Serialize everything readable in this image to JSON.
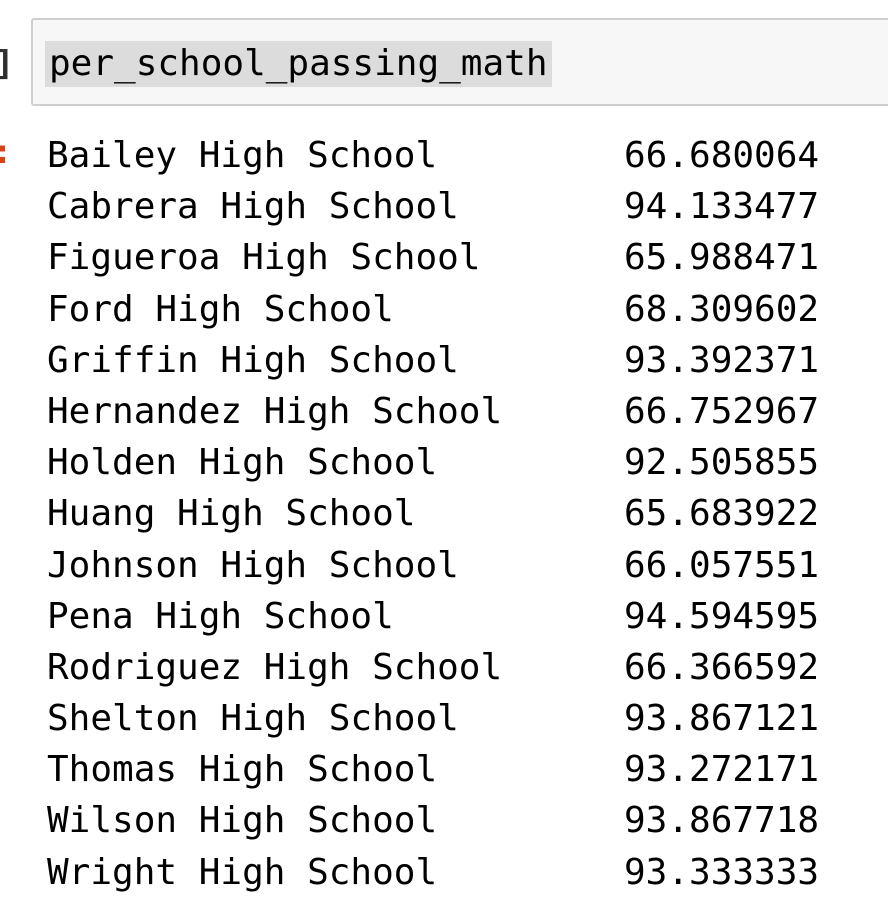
{
  "input": {
    "code": "per_school_passing_math"
  },
  "output": {
    "rows": [
      {
        "school": "Bailey High School",
        "value": "66.680064"
      },
      {
        "school": "Cabrera High School",
        "value": "94.133477"
      },
      {
        "school": "Figueroa High School",
        "value": "65.988471"
      },
      {
        "school": "Ford High School",
        "value": "68.309602"
      },
      {
        "school": "Griffin High School",
        "value": "93.392371"
      },
      {
        "school": "Hernandez High School",
        "value": "66.752967"
      },
      {
        "school": "Holden High School",
        "value": "92.505855"
      },
      {
        "school": "Huang High School",
        "value": "65.683922"
      },
      {
        "school": "Johnson High School",
        "value": "66.057551"
      },
      {
        "school": "Pena High School",
        "value": "94.594595"
      },
      {
        "school": "Rodriguez High School",
        "value": "66.366592"
      },
      {
        "school": "Shelton High School",
        "value": "93.867121"
      },
      {
        "school": "Thomas High School",
        "value": "93.272171"
      },
      {
        "school": "Wilson High School",
        "value": "93.867718"
      },
      {
        "school": "Wright High School",
        "value": "93.333333"
      }
    ]
  }
}
